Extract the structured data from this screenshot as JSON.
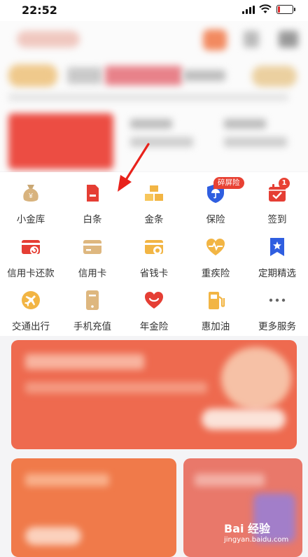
{
  "status": {
    "time": "22:52"
  },
  "grid": {
    "rows": [
      [
        {
          "label": "小金库",
          "icon": "money-bag-icon"
        },
        {
          "label": "白条",
          "icon": "card-icon"
        },
        {
          "label": "金条",
          "icon": "gold-bars-icon"
        },
        {
          "label": "保险",
          "icon": "shield-umbrella-icon"
        },
        {
          "label": "签到",
          "icon": "calendar-check-icon"
        }
      ],
      [
        {
          "label": "信用卡还款",
          "icon": "card-refresh-icon"
        },
        {
          "label": "信用卡",
          "icon": "credit-card-icon"
        },
        {
          "label": "省钱卡",
          "icon": "coupon-card-icon"
        },
        {
          "label": "重疾险",
          "icon": "heart-pulse-icon"
        },
        {
          "label": "定期精选",
          "icon": "bookmark-star-icon"
        }
      ],
      [
        {
          "label": "交通出行",
          "icon": "airplane-icon"
        },
        {
          "label": "手机充值",
          "icon": "phone-icon"
        },
        {
          "label": "年金险",
          "icon": "heart-icon"
        },
        {
          "label": "惠加油",
          "icon": "fuel-pump-icon"
        },
        {
          "label": "更多服务",
          "icon": "more-dots-icon"
        }
      ]
    ],
    "insurance_tag": "碎屏险",
    "signin_badge": "1"
  },
  "watermark": {
    "brand": "Bai 经验",
    "url": "jingyan.baidu.com"
  },
  "colors": {
    "accent": "#e84133",
    "gold": "#f2b544",
    "blue": "#2f5ee0"
  }
}
